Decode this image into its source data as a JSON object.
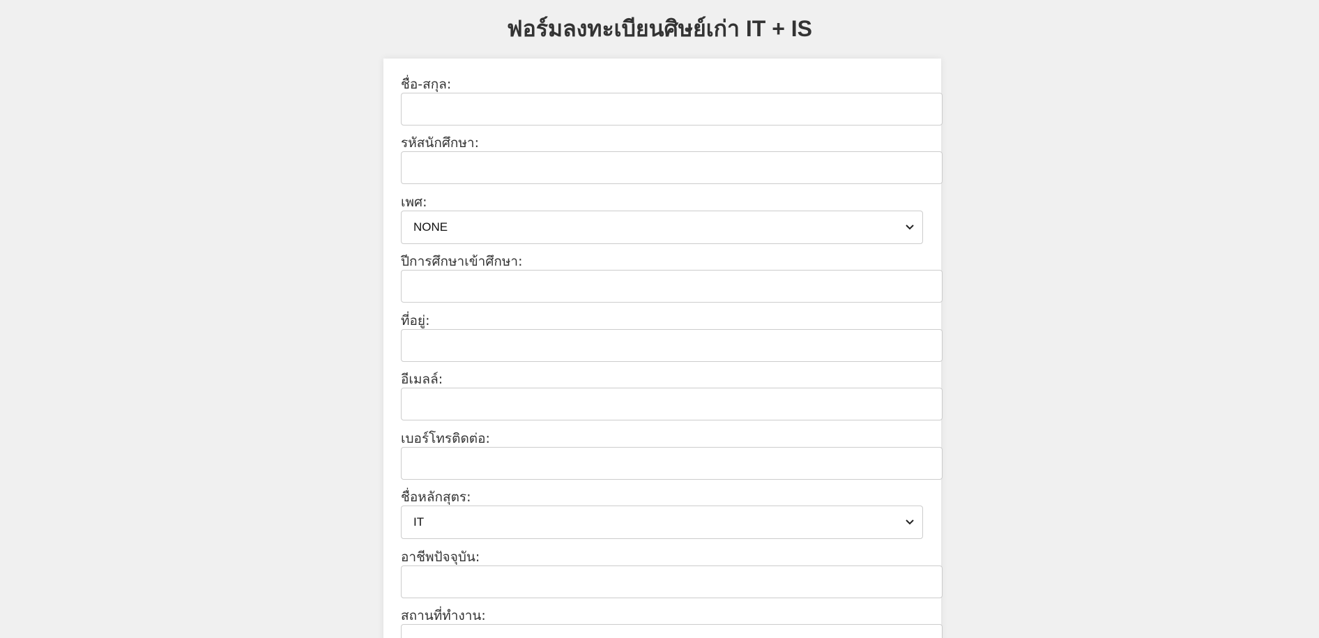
{
  "header": {
    "title": "ฟอร์มลงทะเบียนศิษย์เก่า IT + IS"
  },
  "form": {
    "fullname_label": "ชื่อ-สกุล:",
    "student_id_label": "รหัสนักศึกษา:",
    "gender_label": "เพศ:",
    "gender_selected": "NONE",
    "entry_year_label": "ปีการศึกษาเข้าศึกษา:",
    "address_label": "ที่อยู่:",
    "email_label": "อีเมลล์:",
    "phone_label": "เบอร์โทรติดต่อ:",
    "program_label": "ชื่อหลักสุตร:",
    "program_selected": "IT",
    "occupation_label": "อาชีพปัจจุบัน:",
    "workplace_label": "สถานที่ทำงาน:"
  },
  "icons": {
    "select_arrow": "chevron-down-icon"
  },
  "colors": {
    "background": "#f0f0f0",
    "card": "#ffffff",
    "border": "#cccccc",
    "text": "#333333"
  }
}
